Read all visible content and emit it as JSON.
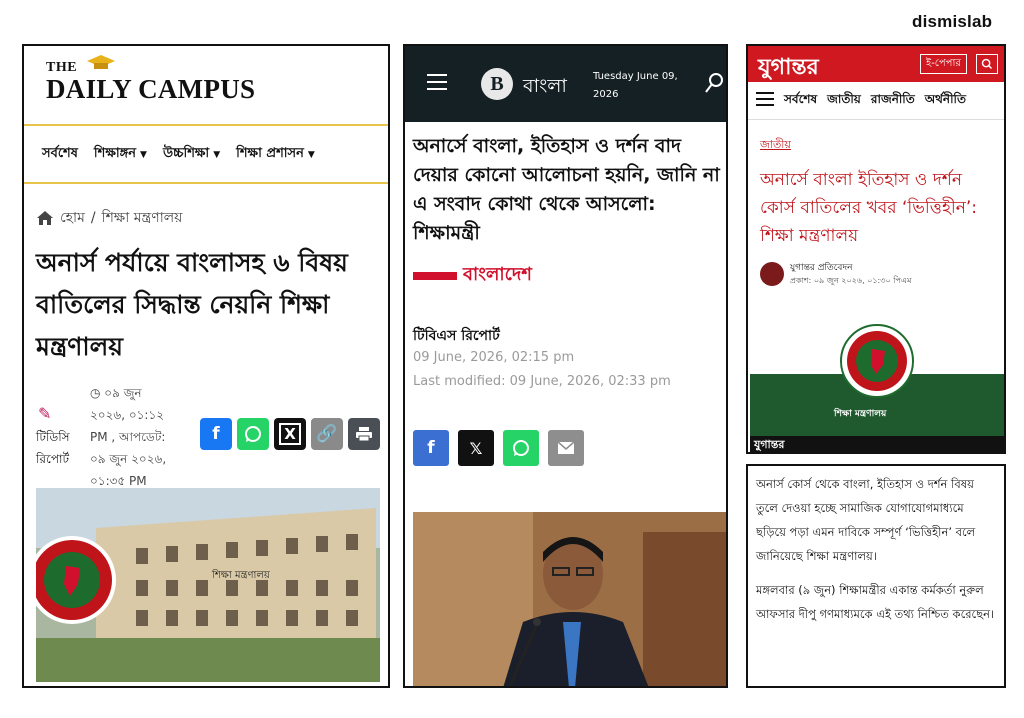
{
  "brand": "dismislab",
  "daily_campus": {
    "logo_the": "THE",
    "logo_name": "DAILY CAMPUS",
    "nav": [
      "সর্বশেষ",
      "শিক্ষাঙ্গন",
      "উচ্চশিক্ষা",
      "শিক্ষা প্রশাসন"
    ],
    "breadcrumb_home": "হোম",
    "breadcrumb_sep": "/",
    "breadcrumb_section": "শিক্ষা মন্ত্রণালয়",
    "headline": "অনার্স পর্যায়ে বাংলাসহ ৬ বিষয় বাতিলের সিদ্ধান্ত নেয়নি শিক্ষা মন্ত্রণালয়",
    "author": "টিডিসি রিপোর্ট",
    "date_lines": [
      "০৯ জুন",
      "২০২৬, ০১:১২",
      "PM , আপডেট:",
      "০৯ জুন ২০২৬,",
      "০১:৩৫ PM"
    ],
    "photo_caption": "শিক্ষা মন্ত্রণালয়",
    "share_colors": {
      "facebook": "#1877f2",
      "whatsapp": "#25d366",
      "x": "#111111",
      "link": "#8a8a8a",
      "print": "#4a4f55"
    }
  },
  "tbs": {
    "logo_letter": "B",
    "logo_name": "বাংলা",
    "date_line1": "Tuesday June 09,",
    "date_line2": "2026",
    "headline": "অনার্সে বাংলা, ইতিহাস ও দর্শন বাদ দেয়ার কোনো আলোচনা হয়নি, জানি না এ সংবাদ কোথা থেকে আসলো: শিক্ষামন্ত্রী",
    "section": "বাংলাদেশ",
    "reporter": "টিবিএস রিপোর্ট",
    "published": "09 June, 2026, 02:15 pm",
    "modified": "Last modified: 09 June, 2026, 02:33 pm",
    "accent": "#d0102c",
    "header_color": "#152024"
  },
  "jugantor": {
    "logo": "যুগান্তর",
    "epaper": "ই-পেপার",
    "nav": [
      "সর্বশেষ",
      "জাতীয়",
      "রাজনীতি",
      "অর্থনীতি"
    ],
    "category": "জাতীয়",
    "headline": "অনার্সে বাংলা ইতিহাস ও দর্শন কোর্স বাতিলের খবর ‘ভিত্তিহীন’: শিক্ষা মন্ত্রণালয়",
    "author": "যুগান্তর প্রতিবেদন",
    "published": "প্রকাশ: ০৯ জুন ২০২৬, ০১:৩০ পিএম",
    "image_caption": "শিক্ষা মন্ত্রণালয়",
    "footer_logo": "যুগান্তর",
    "brand_color": "#d01820"
  },
  "article_text": {
    "p1": "অনার্স কোর্স থেকে বাংলা, ইতিহাস ও দর্শন বিষয় তুলে দেওয়া হচ্ছে সামাজিক যোগাযোগমাধ্যমে ছড়িয়ে পড়া এমন দাবিকে সম্পূর্ণ ‘ভিত্তিহীন’ বলে জানিয়েছে শিক্ষা মন্ত্রণালয়।",
    "p2": "মঙ্গলবার (৯ জুন) শিক্ষামন্ত্রীর একান্ত কর্মকর্তা নুরুল আফসার দীপু গণমাধ্যমকে এই তথ্য নিশ্চিত করেছেন।"
  }
}
